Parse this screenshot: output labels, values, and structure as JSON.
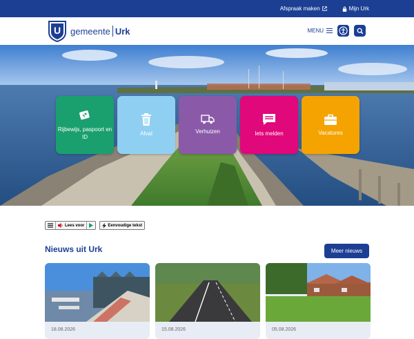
{
  "topbar": {
    "appointment_label": "Afspraak maken",
    "account_label": "Mijn Urk"
  },
  "header": {
    "logo_letter": "U",
    "logo_prefix": "gemeente",
    "logo_name": "Urk",
    "menu_label": "MENU"
  },
  "tiles": [
    {
      "label": "Rijbewijs, paspoort en ID",
      "color": "#1aa06e",
      "icon": "id-card-icon"
    },
    {
      "label": "Afval",
      "color": "#8fd0f2",
      "icon": "trash-icon"
    },
    {
      "label": "Verhuizen",
      "color": "#8a5aa8",
      "icon": "moving-truck-icon"
    },
    {
      "label": "Iets melden",
      "color": "#e0087a",
      "icon": "message-icon"
    },
    {
      "label": "Vacatures",
      "color": "#f4a300",
      "icon": "briefcase-icon"
    }
  ],
  "readspeaker": {
    "read_label": "Lees voor",
    "simple_label": "Eenvoudige tekst"
  },
  "news": {
    "title": "Nieuws uit Urk",
    "more_label": "Meer nieuws",
    "items": [
      {
        "date": "18.08.2026"
      },
      {
        "date": "15.08.2026"
      },
      {
        "date": "05.08.2026"
      }
    ]
  },
  "colors": {
    "brand": "#1c3f94"
  }
}
